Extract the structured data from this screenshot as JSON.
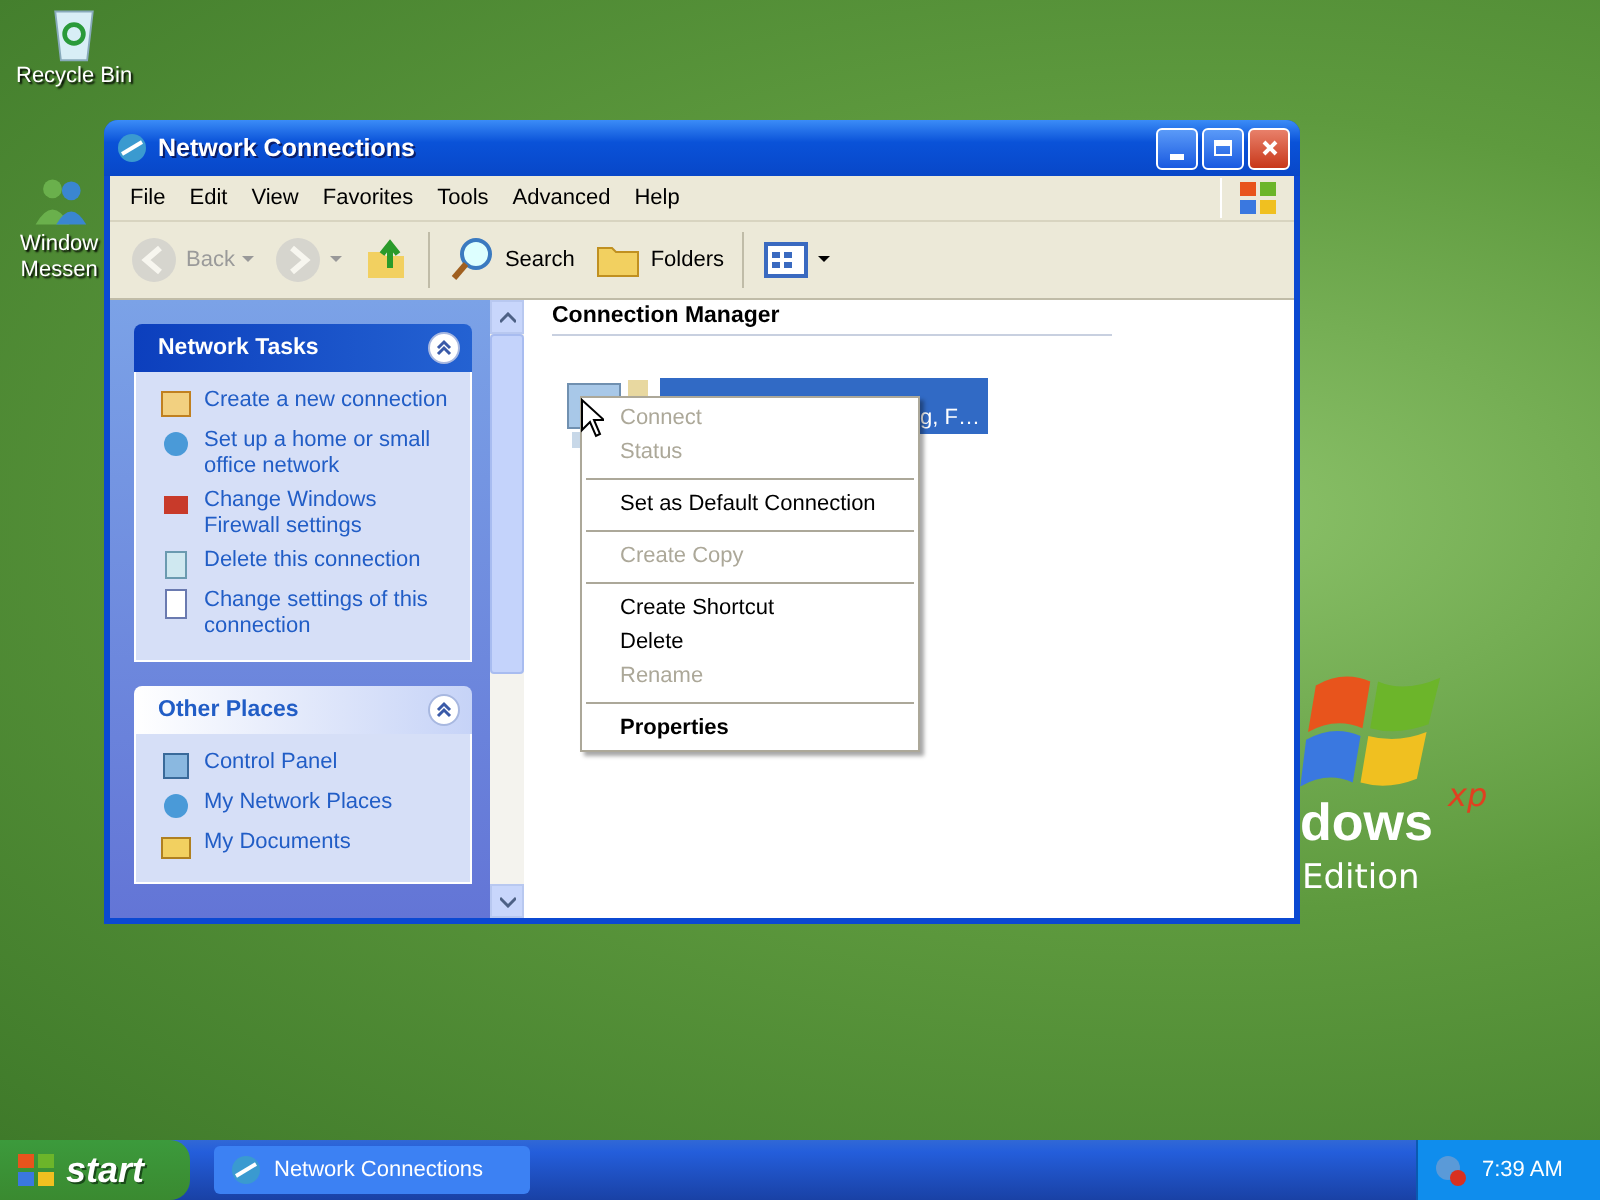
{
  "desktop": {
    "icons": [
      {
        "kind": "recycle",
        "lines": [
          "Recycle Bin"
        ]
      },
      {
        "kind": "messenger",
        "lines": [
          "Window",
          "Messen"
        ]
      }
    ]
  },
  "wallpaper": {
    "texts": [
      "dows",
      "xp",
      "Edition"
    ]
  },
  "window": {
    "title": "Network Connections",
    "menu": [
      "File",
      "Edit",
      "View",
      "Favorites",
      "Tools",
      "Advanced",
      "Help"
    ],
    "toolbar": [
      {
        "kind": "back",
        "label": "Back",
        "disabled": true
      },
      {
        "kind": "forward",
        "disabled": true
      },
      {
        "kind": "up"
      },
      {
        "kind": "search",
        "label": "Search"
      },
      {
        "kind": "folders",
        "label": "Folders"
      },
      {
        "kind": "views"
      }
    ]
  },
  "sidebar": {
    "panels": [
      {
        "title": "Network Tasks",
        "kind": "special",
        "expanded": true,
        "items": [
          {
            "label": "Create a new connection"
          },
          {
            "label": "Set up a home or small office network"
          },
          {
            "label": "Change Windows Firewall settings"
          },
          {
            "label": "Delete this connection"
          },
          {
            "label": "Change settings of this connection"
          }
        ]
      },
      {
        "title": "Other Places",
        "kind": "normal",
        "expanded": true,
        "items": [
          {
            "label": "Control Panel"
          },
          {
            "label": "My Network Places"
          },
          {
            "label": "My Documents"
          }
        ]
      }
    ]
  },
  "content": {
    "group": "Connection Manager",
    "item": {
      "label": "g, F…",
      "selected": true
    }
  },
  "context_menu": [
    {
      "kind": "item",
      "label": "Connect",
      "disabled": true,
      "default": false
    },
    {
      "kind": "item",
      "label": "Status",
      "disabled": true,
      "default": false
    },
    {
      "kind": "separator"
    },
    {
      "kind": "item",
      "label": "Set as Default Connection",
      "disabled": false,
      "default": false
    },
    {
      "kind": "separator"
    },
    {
      "kind": "item",
      "label": "Create Copy",
      "disabled": true,
      "default": false
    },
    {
      "kind": "separator"
    },
    {
      "kind": "item",
      "label": "Create Shortcut",
      "disabled": false,
      "default": false
    },
    {
      "kind": "item",
      "label": "Delete",
      "disabled": false,
      "default": false
    },
    {
      "kind": "item",
      "label": "Rename",
      "disabled": true,
      "default": false
    },
    {
      "kind": "separator"
    },
    {
      "kind": "item",
      "label": "Properties",
      "disabled": false,
      "default": true
    }
  ],
  "taskbar": {
    "start": "start",
    "tasks": [
      {
        "label": "Network Connections",
        "selected": false
      }
    ],
    "clock": "7:39 AM"
  }
}
